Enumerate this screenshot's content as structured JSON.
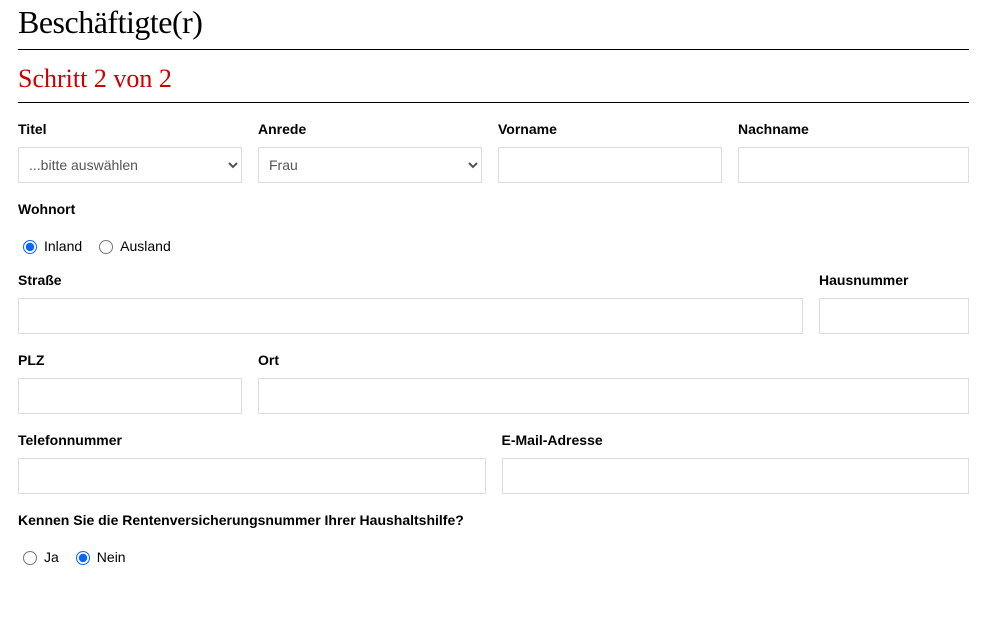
{
  "heading": "Beschäftigte(r)",
  "step": "Schritt 2 von 2",
  "labels": {
    "titel": "Titel",
    "anrede": "Anrede",
    "vorname": "Vorname",
    "nachname": "Nachname",
    "wohnort": "Wohnort",
    "strasse": "Straße",
    "hausnummer": "Hausnummer",
    "plz": "PLZ",
    "ort": "Ort",
    "telefon": "Telefonnummer",
    "email": "E-Mail-Adresse",
    "rv_frage": "Kennen Sie die Rentenversicherungsnummer Ihrer Haushaltshilfe?"
  },
  "titel_select": {
    "selected": "...bitte auswählen"
  },
  "anrede_select": {
    "selected": "Frau"
  },
  "wohnort_options": {
    "inland": "Inland",
    "ausland": "Ausland",
    "selected": "inland"
  },
  "rv_options": {
    "ja": "Ja",
    "nein": "Nein",
    "selected": "nein"
  },
  "values": {
    "vorname": "",
    "nachname": "",
    "strasse": "",
    "hausnummer": "",
    "plz": "",
    "ort": "",
    "telefon": "",
    "email": ""
  }
}
